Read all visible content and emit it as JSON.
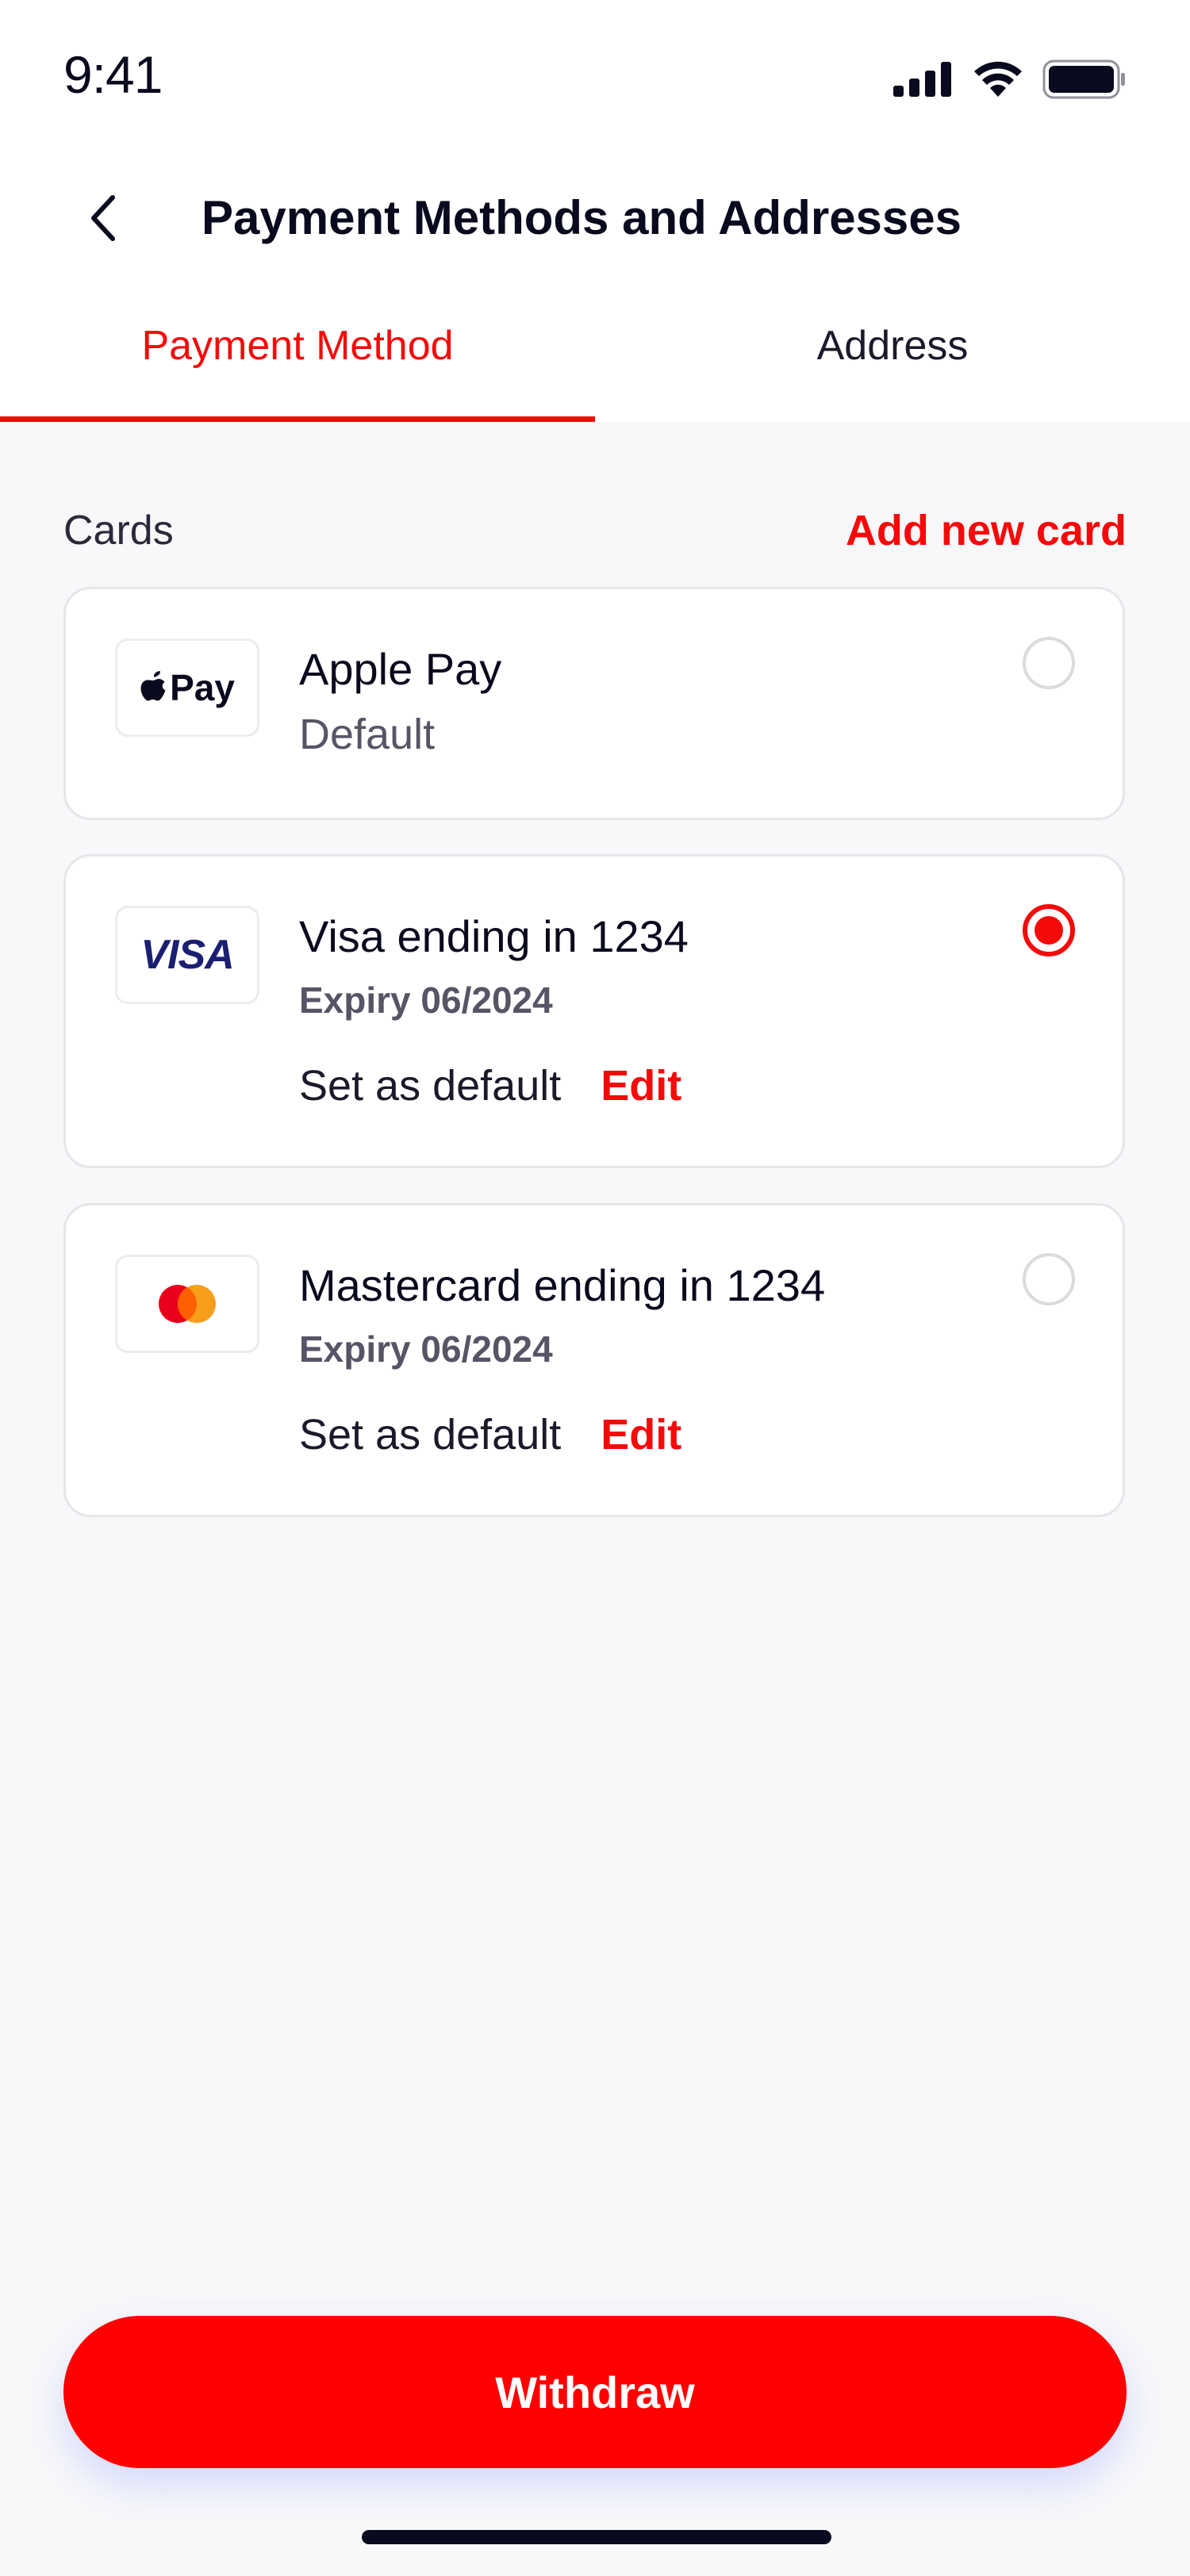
{
  "status_bar": {
    "time": "9:41"
  },
  "header": {
    "title": "Payment Methods and Addresses"
  },
  "tabs": [
    {
      "label": "Payment Method",
      "active": true
    },
    {
      "label": "Address",
      "active": false
    }
  ],
  "section": {
    "title": "Cards",
    "add_link": "Add new card"
  },
  "cards": [
    {
      "logo_text": "Pay",
      "name": "Apple Pay",
      "subtitle": "Default",
      "selected": false
    },
    {
      "logo_text": "VISA",
      "name": "Visa ending in 1234",
      "expiry": "Expiry 06/2024",
      "set_default": "Set as default",
      "edit": "Edit",
      "selected": true
    },
    {
      "logo_icon": "mastercard-logo",
      "name": "Mastercard ending in 1234",
      "expiry": "Expiry 06/2024",
      "set_default": "Set as default",
      "edit": "Edit",
      "selected": false
    }
  ],
  "withdraw_button": "Withdraw",
  "colors": {
    "accent": "#F50A0A",
    "background": "#F8F8FA",
    "card_border": "#E6E6EA",
    "text_primary": "#0A0A1E",
    "text_secondary": "#555566",
    "visa_blue": "#1A1F71",
    "mastercard_red": "#EB001B",
    "mastercard_orange": "#F79E1B"
  },
  "icons": {
    "back": "chevron-left-icon",
    "signal": "cellular-signal-icon",
    "wifi": "wifi-icon",
    "battery": "battery-icon",
    "apple": "apple-logo-icon"
  }
}
